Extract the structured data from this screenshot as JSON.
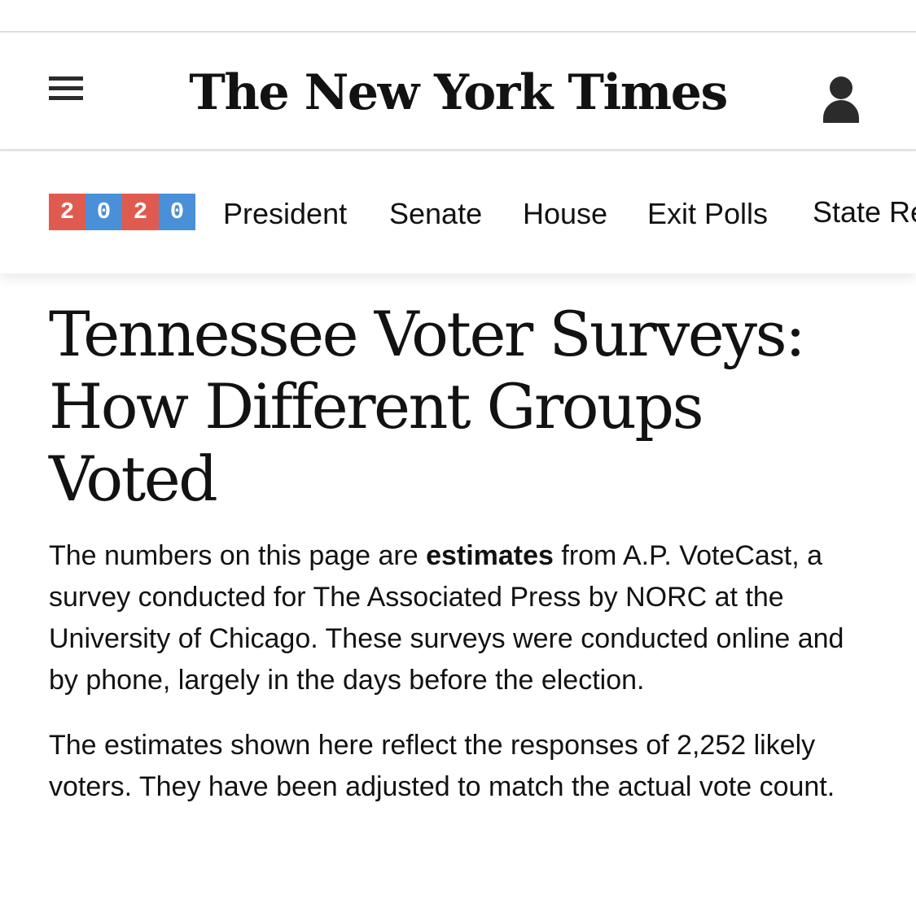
{
  "masthead": {
    "logo_text": "The New York Times",
    "menu_icon": "hamburger-icon",
    "account_icon": "user-icon"
  },
  "subnav": {
    "year_digits": [
      {
        "digit": "2",
        "color": "#e05b4f"
      },
      {
        "digit": "0",
        "color": "#4a90d9"
      },
      {
        "digit": "2",
        "color": "#e05b4f"
      },
      {
        "digit": "0",
        "color": "#4a90d9"
      }
    ],
    "items": [
      "President",
      "Senate",
      "House",
      "Exit Polls",
      "State Re"
    ]
  },
  "article": {
    "headline": "Tennessee Voter Surveys: How Different Groups Voted",
    "paragraph1": {
      "before": "The numbers on this page are ",
      "bold": "estimates",
      "after": " from A.P. VoteCast, a survey conducted for The Associated Press by NORC at the University of Chicago. These surveys were conducted online and by phone, largely in the days before the election."
    },
    "paragraph2": "The estimates shown here reflect the responses of 2,252 likely voters. They have been adjusted to match the actual vote count."
  }
}
